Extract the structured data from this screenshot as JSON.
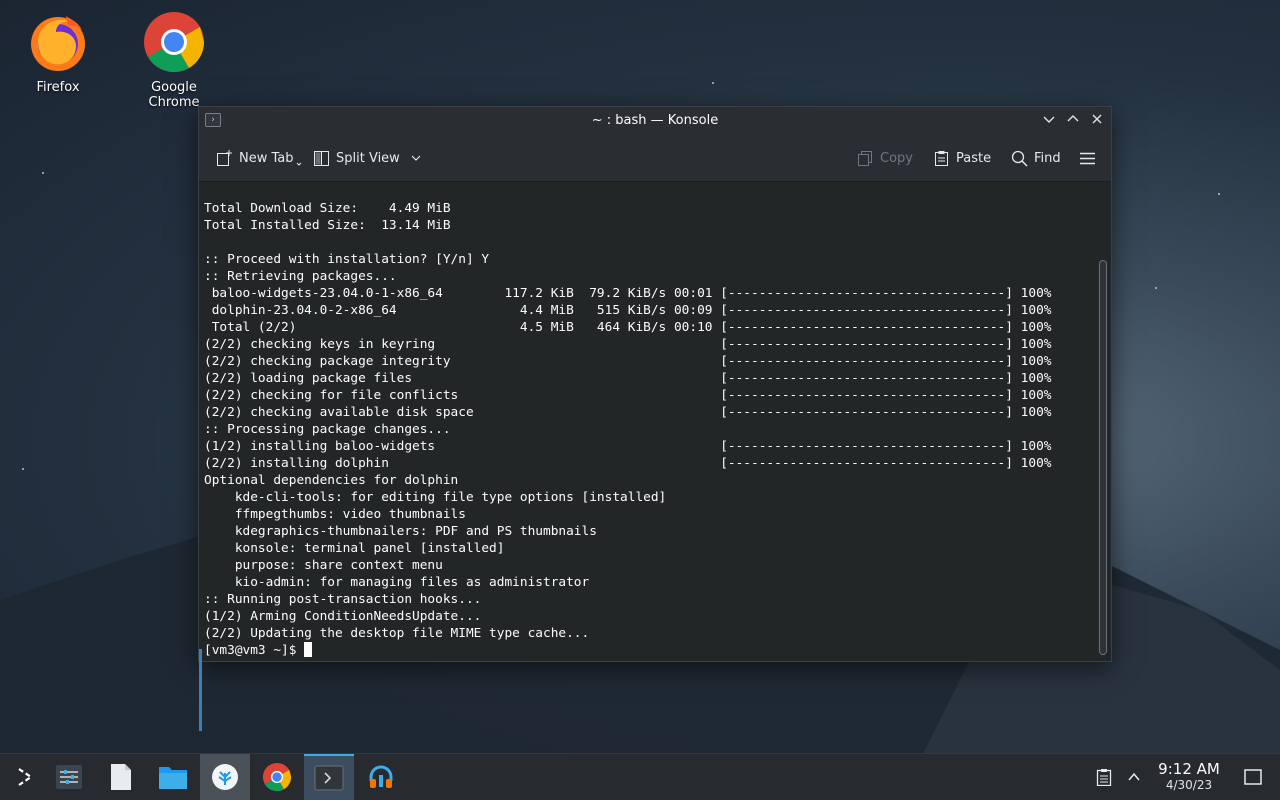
{
  "desktop": {
    "icons": [
      {
        "label": "Firefox",
        "icon": "firefox-icon"
      },
      {
        "label": "Google Chrome",
        "icon": "chrome-icon"
      }
    ]
  },
  "window": {
    "title": "~ : bash — Konsole",
    "toolbar": {
      "new_tab": "New Tab",
      "split_view": "Split View",
      "copy": "Copy",
      "paste": "Paste",
      "find": "Find"
    },
    "terminal": {
      "lines": [
        "Total Download Size:    4.49 MiB",
        "Total Installed Size:  13.14 MiB",
        "",
        ":: Proceed with installation? [Y/n] Y",
        ":: Retrieving packages...",
        " baloo-widgets-23.04.0-1-x86_64        117.2 KiB  79.2 KiB/s 00:01 [------------------------------------] 100%",
        " dolphin-23.04.0-2-x86_64                4.4 MiB   515 KiB/s 00:09 [------------------------------------] 100%",
        " Total (2/2)                             4.5 MiB   464 KiB/s 00:10 [------------------------------------] 100%",
        "(2/2) checking keys in keyring                                     [------------------------------------] 100%",
        "(2/2) checking package integrity                                   [------------------------------------] 100%",
        "(2/2) loading package files                                        [------------------------------------] 100%",
        "(2/2) checking for file conflicts                                  [------------------------------------] 100%",
        "(2/2) checking available disk space                                [------------------------------------] 100%",
        ":: Processing package changes...",
        "(1/2) installing baloo-widgets                                     [------------------------------------] 100%",
        "(2/2) installing dolphin                                           [------------------------------------] 100%",
        "Optional dependencies for dolphin",
        "    kde-cli-tools: for editing file type options [installed]",
        "    ffmpegthumbs: video thumbnails",
        "    kdegraphics-thumbnailers: PDF and PS thumbnails",
        "    konsole: terminal panel [installed]",
        "    purpose: share context menu",
        "    kio-admin: for managing files as administrator",
        ":: Running post-transaction hooks...",
        "(1/2) Arming ConditionNeedsUpdate...",
        "(2/2) Updating the desktop file MIME type cache..."
      ],
      "prompt": "[vm3@vm3 ~]$ "
    }
  },
  "taskbar": {
    "items": [
      {
        "name": "app-launcher",
        "icon": "launcher-icon"
      },
      {
        "name": "system-settings",
        "icon": "settings-sliders-icon"
      },
      {
        "name": "text-editor",
        "icon": "document-icon"
      },
      {
        "name": "file-manager",
        "icon": "folder-icon"
      },
      {
        "name": "discover",
        "icon": "discover-icon"
      },
      {
        "name": "google-chrome",
        "icon": "chrome-icon"
      },
      {
        "name": "konsole",
        "icon": "terminal-icon",
        "active": true
      },
      {
        "name": "audio-app",
        "icon": "headphones-icon"
      }
    ],
    "clock": {
      "time": "9:12 AM",
      "date": "4/30/23"
    }
  },
  "colors": {
    "accent": "#3daee9",
    "terminal_bg": "#232627",
    "terminal_fg": "#fcfcfc",
    "panel_bg": "#272b30"
  }
}
